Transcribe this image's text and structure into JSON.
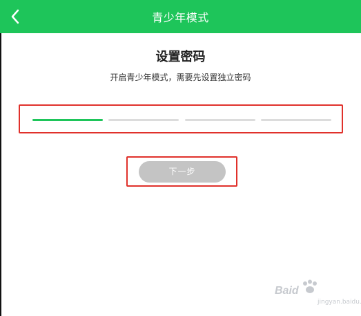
{
  "header": {
    "title": "青少年模式",
    "back_icon": "chevron-left-icon",
    "background_color": "#1ec55a"
  },
  "main": {
    "heading": "设置密码",
    "subheading": "开启青少年模式，需要先设置独立密码",
    "password_slots": {
      "count": 4,
      "filled": 1,
      "active_color": "#1ec55a",
      "inactive_color": "#dcdcdc"
    },
    "next_button_label": "下一步"
  },
  "watermark": {
    "brand": "Baid",
    "sub": "jingyan.baidu.com"
  },
  "highlight_color": "#e0312b"
}
